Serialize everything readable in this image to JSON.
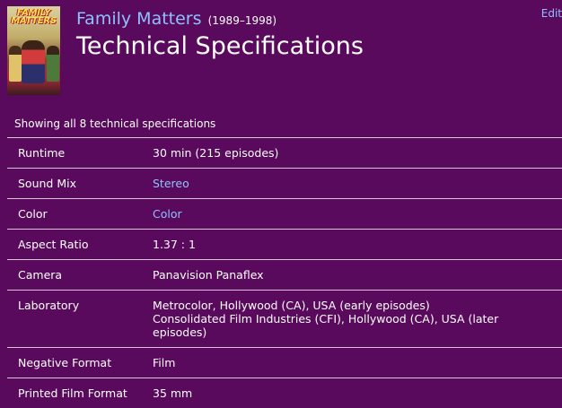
{
  "header": {
    "poster_title": "FAMILY MATTERS",
    "series_title": "Family Matters",
    "years": "(1989–1998)",
    "page_title": "Technical Specifications",
    "edit_label": "Edit"
  },
  "summary": "Showing all 8 technical specifications",
  "specs": [
    {
      "label": "Runtime",
      "value": "30 min (215 episodes)"
    },
    {
      "label": "Sound Mix",
      "value": "Stereo"
    },
    {
      "label": "Color",
      "value": "Color"
    },
    {
      "label": "Aspect Ratio",
      "value": "1.37 : 1"
    },
    {
      "label": "Camera",
      "value": "Panavision Panaflex"
    },
    {
      "label": "Laboratory",
      "value_lines": [
        "Metrocolor, Hollywood (CA), USA (early episodes)",
        "Consolidated Film Industries (CFI), Hollywood (CA), USA (later episodes)"
      ]
    },
    {
      "label": "Negative Format",
      "value": "Film"
    },
    {
      "label": "Printed Film Format",
      "value": "35 mm"
    }
  ],
  "colors": {
    "background": "#5a0a5c",
    "link": "#8ec1ff",
    "text": "#ffffff",
    "divider": "#d8c6d8"
  }
}
